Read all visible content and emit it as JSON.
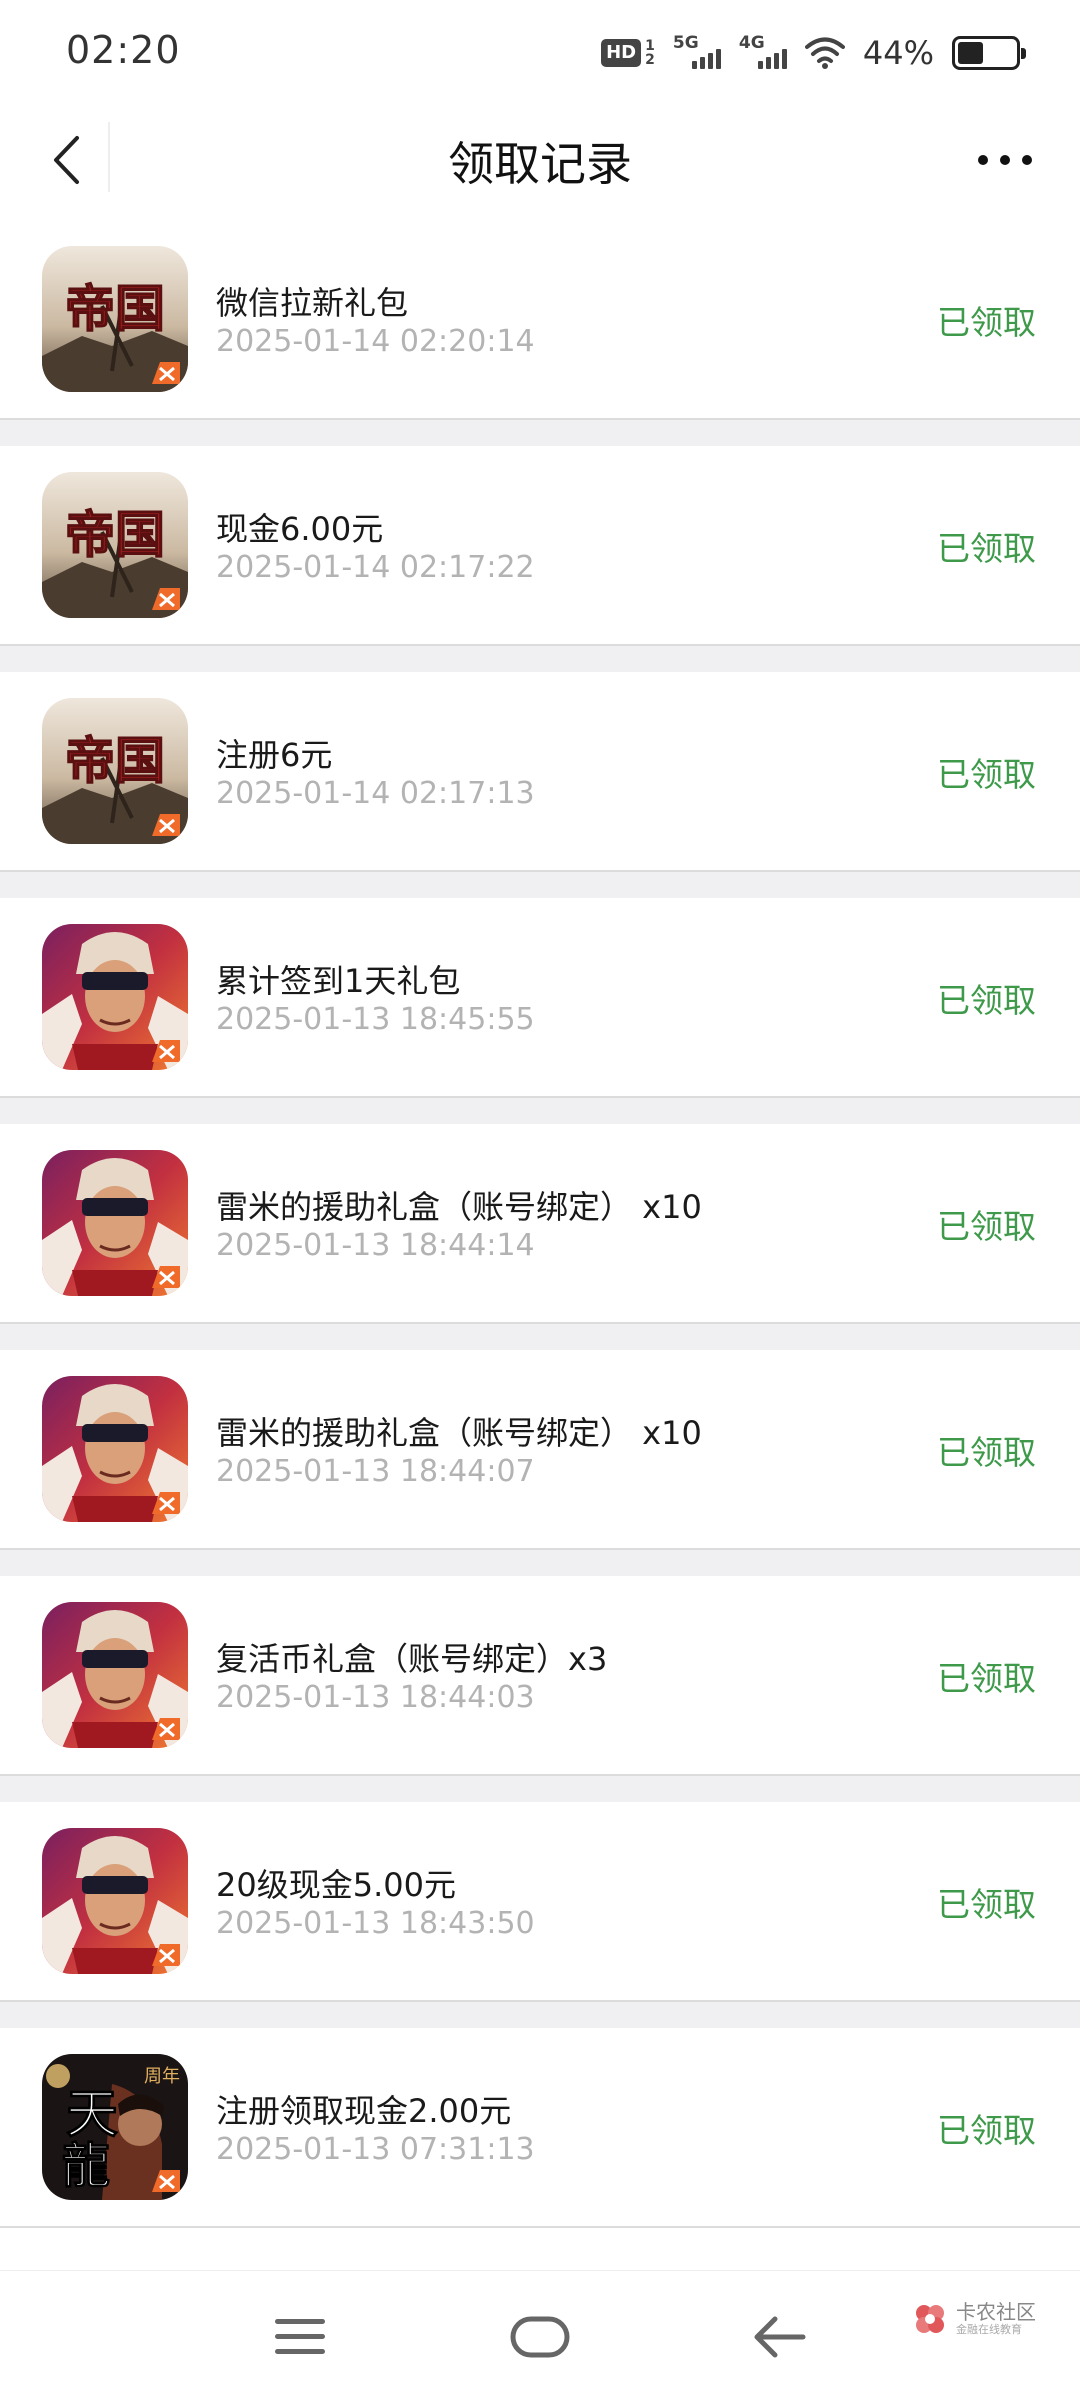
{
  "status_bar": {
    "time": "02:20",
    "hd_label": "HD",
    "hd_top": "1",
    "hd_bottom": "2",
    "net1": "5G",
    "net2": "4G",
    "battery_percent": "44%",
    "battery_level": 0.44
  },
  "header": {
    "title": "领取记录",
    "back_icon": "chevron-left-icon",
    "more_icon": "more-dots-icon"
  },
  "records": [
    {
      "title": "微信拉新礼包",
      "time": "2025-01-14 02:20:14",
      "status": "已领取",
      "game_icon": "帝国"
    },
    {
      "title": "现金6.00元",
      "time": "2025-01-14 02:17:22",
      "status": "已领取",
      "game_icon": "帝国"
    },
    {
      "title": "注册6元",
      "time": "2025-01-14 02:17:13",
      "status": "已领取",
      "game_icon": "帝国"
    },
    {
      "title": "累计签到1天礼包",
      "time": "2025-01-13 18:45:55",
      "status": "已领取",
      "game_icon": "hero-portrait"
    },
    {
      "title": "雷米的援助礼盒（账号绑定） x10",
      "time": "2025-01-13 18:44:14",
      "status": "已领取",
      "game_icon": "hero-portrait"
    },
    {
      "title": "雷米的援助礼盒（账号绑定） x10",
      "time": "2025-01-13 18:44:07",
      "status": "已领取",
      "game_icon": "hero-portrait"
    },
    {
      "title": "复活币礼盒（账号绑定）x3",
      "time": "2025-01-13 18:44:03",
      "status": "已领取",
      "game_icon": "hero-portrait"
    },
    {
      "title": "20级现金5.00元",
      "time": "2025-01-13 18:43:50",
      "status": "已领取",
      "game_icon": "hero-portrait"
    },
    {
      "title": "注册领取现金2.00元",
      "time": "2025-01-13 07:31:13",
      "status": "已领取",
      "game_icon": "天龍"
    }
  ],
  "nav_bar": {
    "menu_icon": "menu-icon",
    "home_icon": "home-icon",
    "back_icon": "back-arrow-icon",
    "watermark_main": "卡农社区",
    "watermark_sub": "金融在线教育"
  },
  "colors": {
    "status_green": "#3e9a4a",
    "timestamp_gray": "#b3b3b3",
    "separator": "#f0f0f2"
  }
}
